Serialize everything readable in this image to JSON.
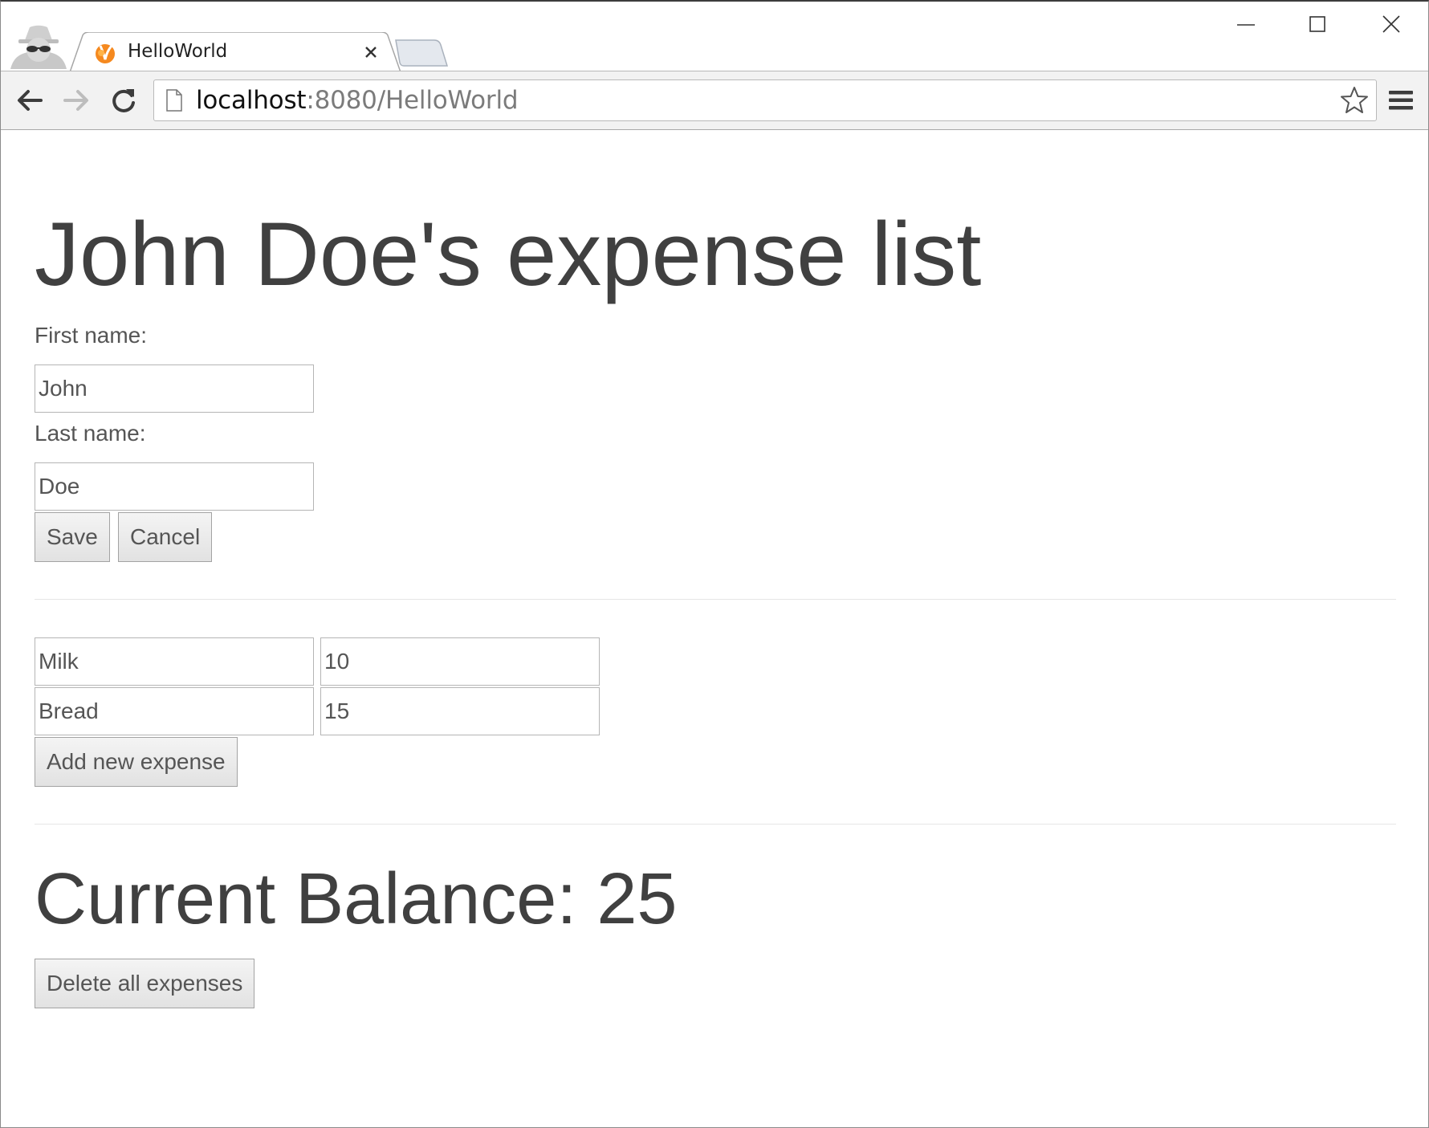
{
  "browser": {
    "tab_title": "HelloWorld",
    "url_host": "localhost",
    "url_rest": ":8080/HelloWorld",
    "icons": {
      "incognito": "incognito-icon",
      "favicon": "vaadin-favicon-icon",
      "tab_close": "close-icon",
      "new_tab": "new-tab-icon",
      "minimize": "minimize-icon",
      "maximize": "maximize-icon",
      "close_window": "close-icon",
      "back": "arrow-left-icon",
      "forward": "arrow-right-icon",
      "reload": "reload-icon",
      "page": "page-icon",
      "bookmark": "star-icon",
      "menu": "hamburger-menu-icon"
    }
  },
  "page": {
    "title": "John Doe's expense list",
    "form": {
      "first_name_label": "First name:",
      "first_name_value": "John",
      "last_name_label": "Last name:",
      "last_name_value": "Doe",
      "save_label": "Save",
      "cancel_label": "Cancel"
    },
    "expenses": [
      {
        "name": "Milk",
        "amount": "10"
      },
      {
        "name": "Bread",
        "amount": "15"
      }
    ],
    "add_expense_label": "Add new expense",
    "balance_text": "Current Balance: 25",
    "delete_all_label": "Delete all expenses"
  },
  "colors": {
    "text": "#404040",
    "field_border": "#b5b5b5",
    "button_border": "#a3a3a3",
    "toolbar_bg": "#f2f2f2",
    "favicon_orange": "#f5891f"
  }
}
